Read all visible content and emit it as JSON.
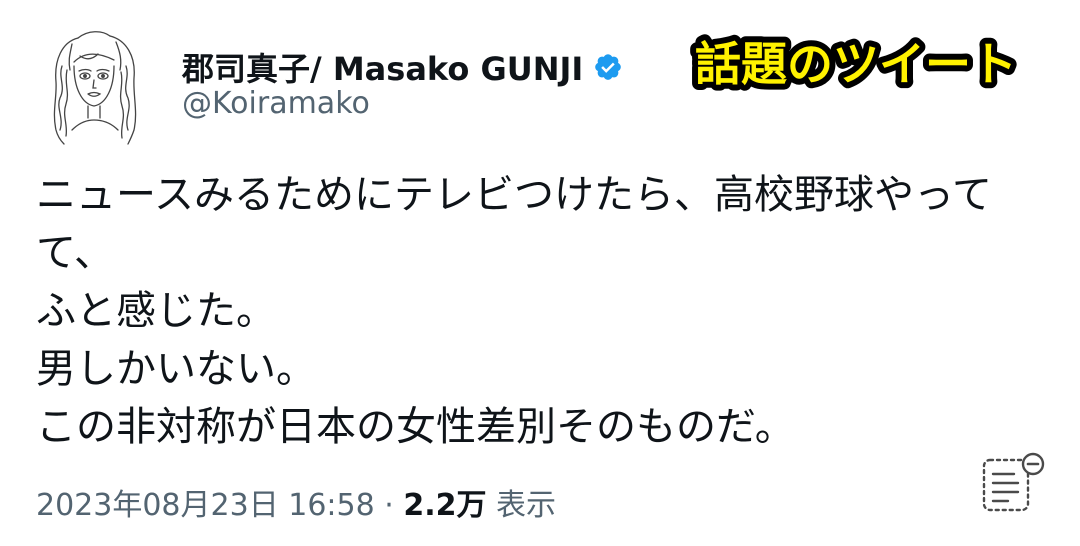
{
  "user": {
    "display_name": "郡司真子/ Masako GUNJI",
    "handle": "@Koiramako",
    "avatar_icon": "avatar-illustration",
    "verified_icon": "verified-badge-icon",
    "verified_color": "#1d9bf0"
  },
  "badge": {
    "text": "話題のツイート",
    "fill_color": "#fff200",
    "outline_color": "#000000"
  },
  "tweet": {
    "lines": [
      "ニュースみるためにテレビつけたら、高校野球やって",
      "て、",
      "ふと感じた。",
      "男しかいない。",
      "この非対称が日本の女性差別そのものだ。"
    ]
  },
  "meta": {
    "timestamp": "2023年08月23日 16:58",
    "separator": "·",
    "views_count": "2.2万",
    "views_label": "表示"
  },
  "actions": {
    "summary_icon": "document-minus-icon"
  },
  "colors": {
    "text": "#0f1419",
    "secondary": "#536471"
  }
}
